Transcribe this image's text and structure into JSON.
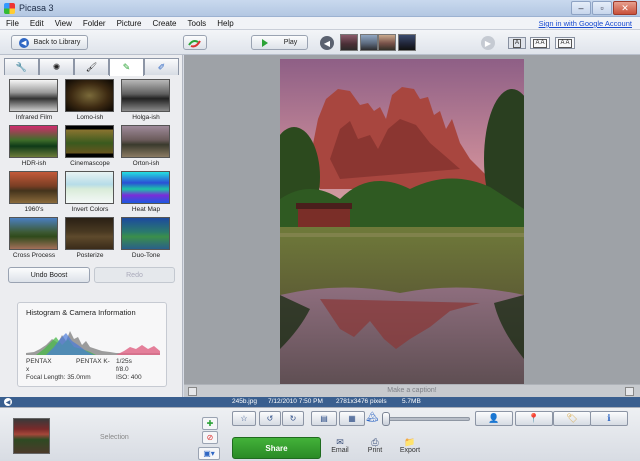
{
  "window": {
    "title": "Picasa 3"
  },
  "menu": {
    "items": [
      "File",
      "Edit",
      "View",
      "Folder",
      "Picture",
      "Create",
      "Tools",
      "Help"
    ],
    "signin": "Sign in with Google Account"
  },
  "toolbar": {
    "back_label": "Back to Library",
    "play_label": "Play",
    "size_labels": [
      "A",
      "A A",
      "A A"
    ]
  },
  "tabs": [
    {
      "icon": "wrench-icon",
      "glyph": "🔧"
    },
    {
      "icon": "brightness-icon",
      "glyph": "✺"
    },
    {
      "icon": "paintbrush-icon",
      "glyph": "🖌"
    },
    {
      "icon": "effects-brush-icon",
      "glyph": "✎"
    },
    {
      "icon": "edit-pencil-icon",
      "glyph": "✐"
    }
  ],
  "effects": [
    "Infrared Film",
    "Lomo-ish",
    "Holga-ish",
    "HDR-ish",
    "Cinemascope",
    "Orton-ish",
    "1960's",
    "Invert Colors",
    "Heat Map",
    "Cross Process",
    "Posterize",
    "Duo-Tone"
  ],
  "edit": {
    "undo_label": "Undo Boost",
    "redo_label": "Redo"
  },
  "histogram": {
    "title": "Histogram & Camera Information",
    "make": "PENTAX",
    "make_wrap": "x",
    "model": "PENTAX K-",
    "exposure": "1/25s",
    "aperture": "f/8.0",
    "focal": "Focal Length: 35.0mm",
    "iso": "ISO: 400"
  },
  "caption": {
    "placeholder": "Make a caption!"
  },
  "status": {
    "filename": "245b.jpg",
    "date": "7/12/2010 7:50 PM",
    "dimensions": "2781x3476 pixels",
    "size": "5.7MB"
  },
  "tray": {
    "selection_label": "Selection",
    "share_label": "Share",
    "email_label": "Email",
    "print_label": "Print",
    "export_label": "Export"
  },
  "colors": {
    "status_bg": "#3a5f8f",
    "share_green": "#2a8a25",
    "link_blue": "#1a4bd0"
  }
}
